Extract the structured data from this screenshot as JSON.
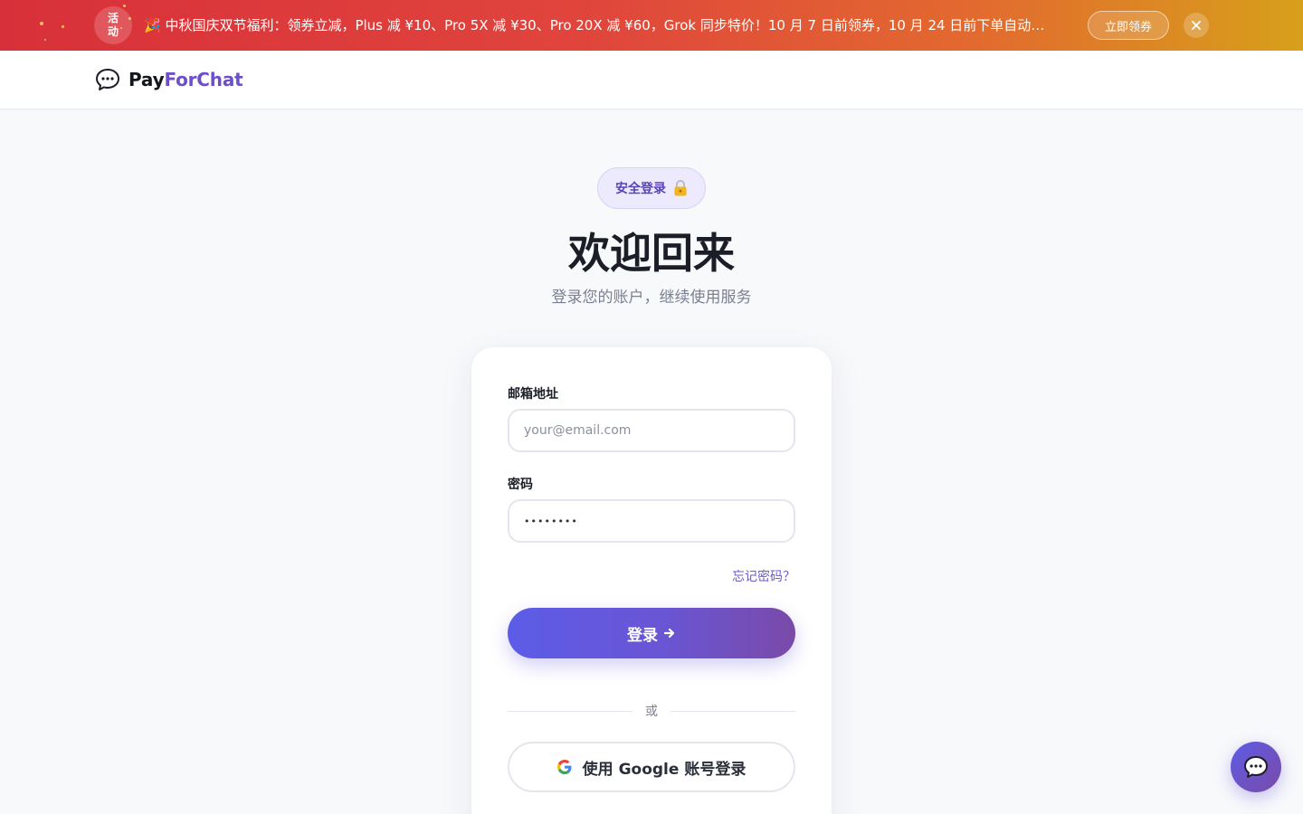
{
  "promo": {
    "badge": "活动",
    "text": "🎉 中秋国庆双节福利：领券立减，Plus 减 ¥10、Pro 5X 减 ¥30、Pro 20X 减 ¥60，Grok 同步特价！10 月 7 日前领券，10 月 24 日前下单自动…",
    "cta_label": "立即领券",
    "close_icon": "close-icon"
  },
  "header": {
    "logo_part1": "Pay",
    "logo_part2": "ForChat",
    "logo_icon": "speech-bubble-icon"
  },
  "hero": {
    "pill_label": "安全登录",
    "pill_icon": "lock-icon",
    "title": "欢迎回来",
    "subtitle": "登录您的账户，继续使用服务"
  },
  "form": {
    "email_label": "邮箱地址",
    "email_placeholder": "your@email.com",
    "email_value": "",
    "password_label": "密码",
    "password_value": "••••••••",
    "forgot_label": "忘记密码？",
    "login_label": "登录",
    "login_icon": "arrow-right-icon",
    "or_label": "或",
    "google_label": "使用 Google 账号登录",
    "google_icon": "google-icon"
  },
  "chat_fab": {
    "icon": "chat-bubble-icon"
  },
  "colors": {
    "accent": "#6d4fc8",
    "banner_start": "#d8303a",
    "banner_end": "#d7a01a",
    "button_start": "#5c5ce8",
    "button_end": "#7a4aa8"
  }
}
